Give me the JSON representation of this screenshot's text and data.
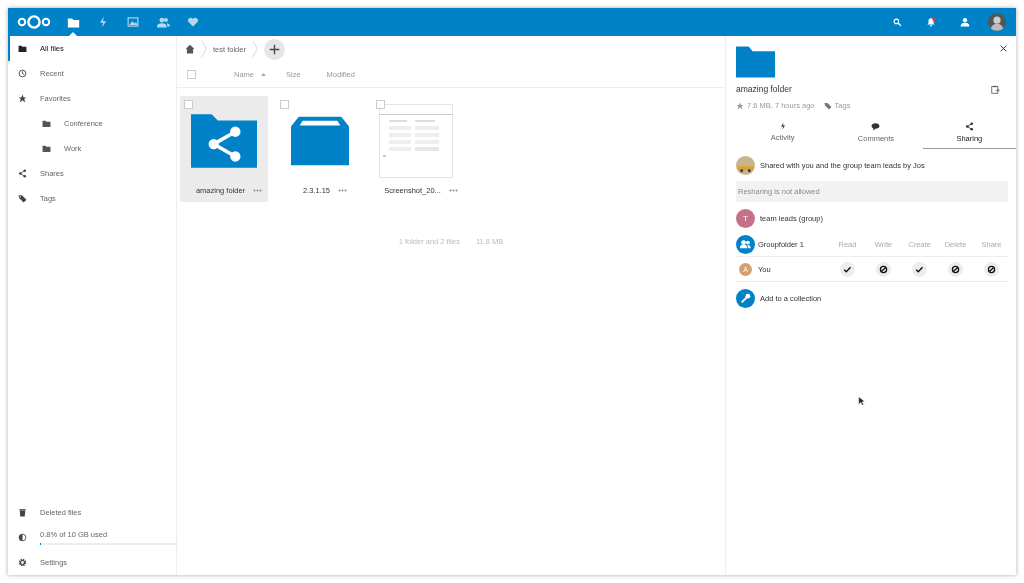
{
  "topbar": {
    "apps": [
      {
        "kind": "files",
        "selected": true
      },
      {
        "kind": "activity",
        "selected": false
      },
      {
        "kind": "gallery",
        "selected": false
      },
      {
        "kind": "contacts",
        "selected": false
      },
      {
        "kind": "favorites",
        "selected": false
      }
    ],
    "notifications_unread": true
  },
  "sidebar": {
    "items": [
      {
        "kind": "files",
        "label": "All files",
        "selected": true
      },
      {
        "kind": "recent",
        "label": "Recent",
        "selected": false
      },
      {
        "kind": "favorites",
        "label": "Favorites",
        "selected": false,
        "children": [
          {
            "kind": "folder",
            "label": "Conference",
            "selected": false
          },
          {
            "kind": "folder",
            "label": "Work",
            "selected": false
          }
        ]
      },
      {
        "kind": "shares",
        "label": "Shares",
        "selected": false
      },
      {
        "kind": "tags",
        "label": "Tags",
        "selected": false
      }
    ],
    "deleted": "Deleted files",
    "quota": {
      "label": "0.8% of 10 GB used",
      "level": 0.008
    },
    "settings": "Settings"
  },
  "breadcrumb": [
    "test folder"
  ],
  "select_all": {
    "checked": false
  },
  "columns": [
    {
      "label": "Name",
      "sorted": true
    },
    {
      "label": "Size",
      "sorted": false
    },
    {
      "label": "Modified",
      "sorted": false
    }
  ],
  "files": [
    {
      "kind": "shared-folder",
      "name": "amazing folder",
      "selected": true,
      "checked": false
    },
    {
      "kind": "external-folder",
      "name": "2.3.1.15",
      "selected": false,
      "checked": false
    },
    {
      "kind": "picture",
      "name": "Screenshot_20...",
      "selected": false,
      "checked": false
    }
  ],
  "summary": {
    "count": "1 folder and 2 files",
    "size": "11.8 MB"
  },
  "details": {
    "title": "amazing folder",
    "meta": "7.6 MB, 7 hours ago",
    "tags": "Tags",
    "tabs": [
      {
        "kind": "activity",
        "label": "Activity",
        "selected": false
      },
      {
        "kind": "comments",
        "label": "Comments",
        "selected": false
      },
      {
        "kind": "sharing",
        "label": "Sharing",
        "selected": true
      }
    ],
    "shared_by": "Shared with you and the group team leads by Jos",
    "resharing": "Resharing is not allowed",
    "share": {
      "avatar": "T",
      "color": "#c4728a",
      "name": "team leads (group)"
    },
    "groupfolder": {
      "name": "Groupfolder 1",
      "permissions": [
        "Read",
        "Write",
        "Create",
        "Delete",
        "Share"
      ],
      "rows": [
        {
          "avatar": "A",
          "color": "#d5a06e",
          "name": "You",
          "granted": [
            true,
            false,
            true,
            false,
            false
          ]
        }
      ]
    },
    "collection": "Add to a collection"
  }
}
